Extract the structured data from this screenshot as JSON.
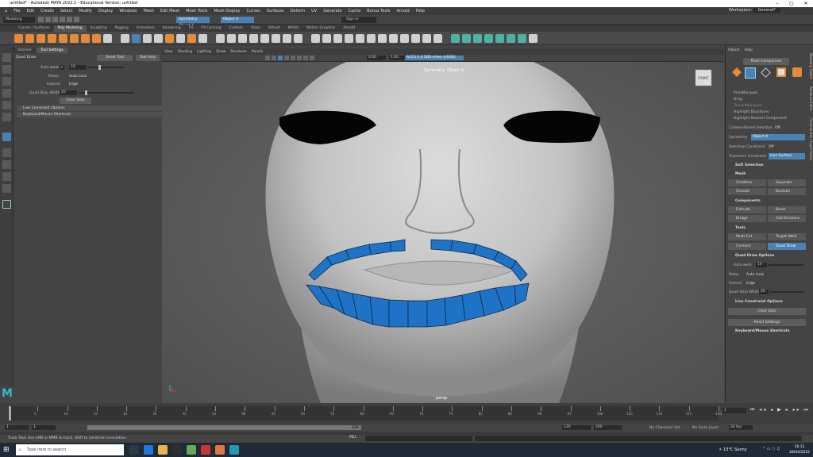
{
  "window": {
    "title": "untitled* - Autodesk MAYA 2022.1 - Educational Version: untitled"
  },
  "menubar": {
    "items": [
      "File",
      "Edit",
      "Create",
      "Select",
      "Modify",
      "Display",
      "Windows",
      "Mesh",
      "Edit Mesh",
      "Mesh Tools",
      "Mesh Display",
      "Curves",
      "Surfaces",
      "Deform",
      "UV",
      "Generate",
      "Cache",
      "Bonus Tools",
      "Arnold",
      "Help"
    ],
    "workspace_label": "Workspace:",
    "workspace_value": "General*"
  },
  "statusline": {
    "mode": "Modeling",
    "symmetry": "Symmetry: Object X",
    "object": "Object X",
    "sign_in": "Sign In"
  },
  "shelf": {
    "tabs": [
      "Curves / Surfaces",
      "Poly Modeling",
      "Sculpting",
      "Rigging",
      "Animation",
      "Rendering",
      "FX",
      "FX Caching",
      "Custom",
      "XGen",
      "Bifrost",
      "MASH",
      "Motion Graphics",
      "Arnold"
    ],
    "active": "Poly Modeling"
  },
  "left_panel": {
    "tabs": [
      "Outliner",
      "Tool Settings"
    ],
    "tool_name": "Quad Draw",
    "reset_tool": "Reset Tool",
    "tool_help": "Tool Help",
    "auto_weld_label": "Auto weld:",
    "auto_weld_value": "10",
    "relax_label": "Relax:",
    "relax_value": "Auto Lock",
    "extend_label": "Extend:",
    "extend_value": "Edge",
    "quad_strip_label": "Quad Strip Width:",
    "quad_strip_value": "20",
    "clear_dots": "Clear Dots",
    "section1": "Live Constraint Options",
    "section2": "Keyboard/Mouse Shortcuts"
  },
  "viewport": {
    "menu": [
      "View",
      "Shading",
      "Lighting",
      "Show",
      "Renderer",
      "Panels"
    ],
    "field1": "0.00",
    "field2": "1.00",
    "color_space": "ACES 1.0 SDR-video (sRGB)",
    "symmetry_label": "Symmetry: Object X",
    "camera_label": "persp",
    "cube_label": "FRONT"
  },
  "right_panel": {
    "tabs": [
      "Object",
      "Help"
    ],
    "multi_component": "Multi-Component",
    "pick_marquee": "Pick/Marquee",
    "drag": "Drag",
    "tweak_marquee": "Tweak/Marquee",
    "highlight_backfaces": "Highlight Backfaces",
    "highlight_nearest": "Highlight Nearest Component",
    "camera_based": "Camera-Based Selection",
    "camera_based_value": "Off",
    "symmetry_label": "Symmetry",
    "symmetry_value": "Object X",
    "selection_constraint": "Selection Constraint",
    "selection_constraint_value": "Off",
    "transform_constraint": "Transform Constraint",
    "transform_constraint_value": "Live Surface",
    "soft_selection": "Soft Selection",
    "mesh": "Mesh",
    "combine": "Combine",
    "separate": "Separate",
    "smooth": "Smooth",
    "boolean": "Boolean",
    "components": "Components",
    "extrude": "Extrude",
    "bevel": "Bevel",
    "bridge": "Bridge",
    "add_divisions": "Add Divisions",
    "tools": "Tools",
    "multi_cut": "Multi-Cut",
    "target_weld": "Target Weld",
    "connect": "Connect",
    "quad_draw": "Quad Draw",
    "quad_draw_options": "Quad Draw Options",
    "auto_weld": "Auto weld",
    "auto_weld_value": "10",
    "relax": "Relax",
    "relax_value": "Auto Lock",
    "extend": "Extend",
    "extend_value": "Edge",
    "quad_strip": "Quad Strip Width",
    "quad_strip_value": "20",
    "live_constraint": "Live Constraint Options",
    "clear_dots": "Clear Dots",
    "reset_settings": "Reset Settings",
    "keyboard_shortcuts": "Keyboard/Mouse Shortcuts",
    "side_tabs": [
      "Modeling Toolkit",
      "Attribute Editor",
      "Channel Box / Layer Editor"
    ]
  },
  "timeline": {
    "ticks": [
      "5",
      "10",
      "15",
      "20",
      "25",
      "30",
      "35",
      "40",
      "45",
      "50",
      "55",
      "60",
      "65",
      "70",
      "75",
      "80",
      "85",
      "90",
      "95",
      "100",
      "105",
      "110",
      "115",
      "120"
    ],
    "current_frame": "1",
    "range_start": "1",
    "range_start2": "1",
    "range_mid": "120",
    "range_end": "120",
    "range_end2": "200",
    "fps": "24 fps",
    "character_set": "No Character Set",
    "anim_layer": "No Anim Layer"
  },
  "command": {
    "mel": "MEL",
    "help": "Track Tool: Use LMB or MMB to track. Shift to constrain translation."
  },
  "taskbar": {
    "search_placeholder": "Type here to search",
    "weather": "13°C  Sunny",
    "time": "16:11",
    "date": "28/04/2022"
  },
  "colors": {
    "accent_blue": "#4a82b4",
    "maya_orange": "#e48a3a",
    "quad_blue": "#1f73c7"
  }
}
